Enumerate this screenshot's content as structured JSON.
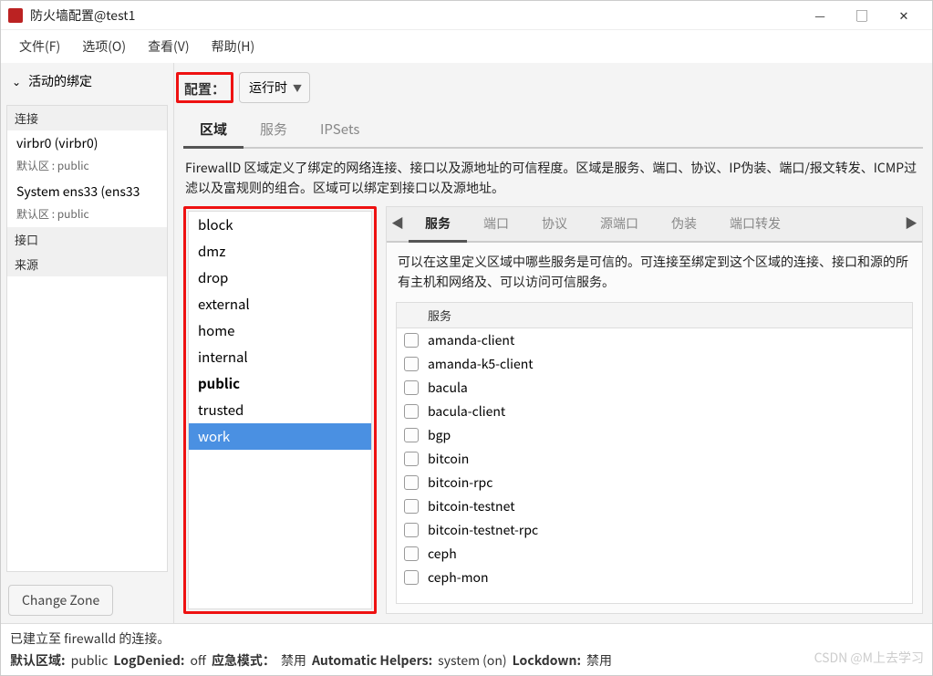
{
  "title": "防火墙配置@test1",
  "menu": {
    "file": "文件(F)",
    "options": "选项(O)",
    "view": "查看(V)",
    "help": "帮助(H)"
  },
  "sidebar": {
    "header": "活动的绑定",
    "connections_label": "连接",
    "conn1": {
      "name": "virbr0 (virbr0)",
      "sub": "默认区 : public"
    },
    "conn2": {
      "name": "System ens33 (ens33",
      "sub": "默认区 : public"
    },
    "interfaces_label": "接口",
    "sources_label": "来源",
    "change_zone": "Change Zone"
  },
  "config": {
    "label": "配置：",
    "value": "运行时"
  },
  "tabs": {
    "zones": "区域",
    "services": "服务",
    "ipsets": "IPSets"
  },
  "zone_desc": "FirewallD 区域定义了绑定的网络连接、接口以及源地址的可信程度。区域是服务、端口、协议、IP伪装、端口/报文转发、ICMP过滤以及富规则的组合。区域可以绑定到接口以及源地址。",
  "zones": [
    "block",
    "dmz",
    "drop",
    "external",
    "home",
    "internal",
    "public",
    "trusted",
    "work"
  ],
  "zone_default": "public",
  "zone_selected": "work",
  "subtabs": {
    "services": "服务",
    "ports": "端口",
    "protocols": "协议",
    "source_ports": "源端口",
    "masquerade": "伪装",
    "port_forward": "端口转发"
  },
  "svc_desc": "可以在这里定义区域中哪些服务是可信的。可连接至绑定到这个区域的连接、接口和源的所有主机和网络及、可以访问可信服务。",
  "svc_header": "服务",
  "services": [
    "amanda-client",
    "amanda-k5-client",
    "bacula",
    "bacula-client",
    "bgp",
    "bitcoin",
    "bitcoin-rpc",
    "bitcoin-testnet",
    "bitcoin-testnet-rpc",
    "ceph",
    "ceph-mon"
  ],
  "status": {
    "line1": "已建立至 firewalld 的连接。",
    "default_zone_label": "默认区域:",
    "default_zone": "public",
    "log_denied_label": "LogDenied:",
    "log_denied": "off",
    "emergency_label": "应急模式：",
    "emergency": "禁用",
    "auto_helpers_label": "Automatic Helpers:",
    "auto_helpers": "system (on)",
    "lockdown_label": "Lockdown:",
    "lockdown": "禁用"
  },
  "watermark": "CSDN @M上去学习"
}
